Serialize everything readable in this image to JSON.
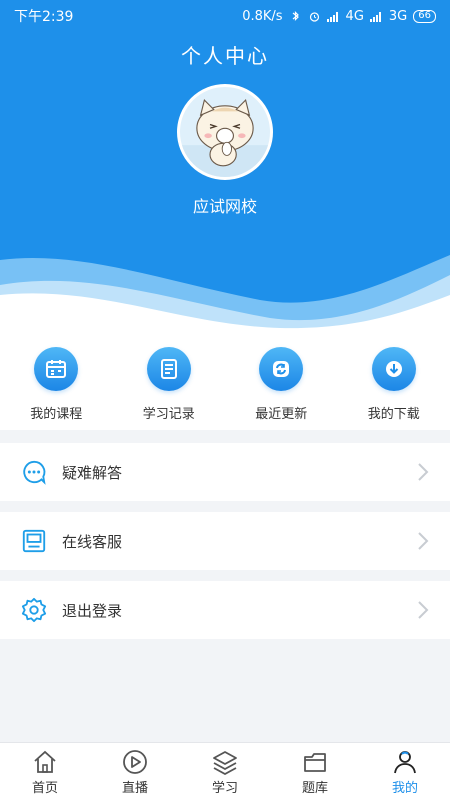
{
  "status": {
    "time": "下午2:39",
    "speed": "0.8K/s",
    "net1": "4G",
    "net2": "3G",
    "battery": "66"
  },
  "header": {
    "title": "个人中心",
    "username": "应试网校"
  },
  "quick": [
    {
      "label": "我的课程",
      "icon": "calendar-icon"
    },
    {
      "label": "学习记录",
      "icon": "clipboard-icon"
    },
    {
      "label": "最近更新",
      "icon": "refresh-icon"
    },
    {
      "label": "我的下载",
      "icon": "download-icon"
    }
  ],
  "menu": [
    {
      "label": "疑难解答",
      "icon": "chat-bubble-icon"
    },
    {
      "label": "在线客服",
      "icon": "service-terminal-icon"
    },
    {
      "label": "退出登录",
      "icon": "settings-gear-icon"
    }
  ],
  "tabs": [
    {
      "label": "首页",
      "icon": "home-icon"
    },
    {
      "label": "直播",
      "icon": "play-circle-icon"
    },
    {
      "label": "学习",
      "icon": "layers-icon"
    },
    {
      "label": "题库",
      "icon": "folder-icon"
    },
    {
      "label": "我的",
      "icon": "user-icon",
      "active": true
    }
  ],
  "colors": {
    "primary": "#1e90ea",
    "background": "#f2f4f7"
  }
}
